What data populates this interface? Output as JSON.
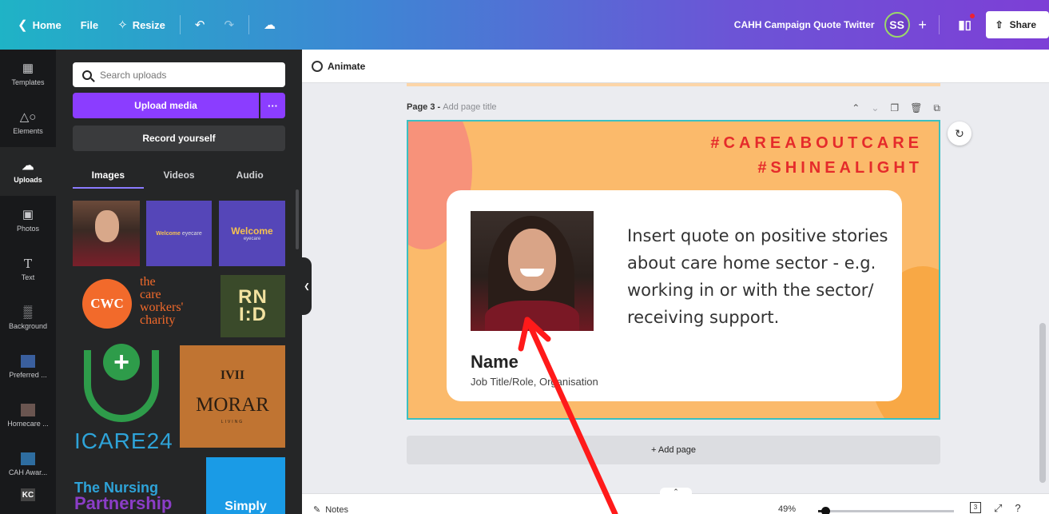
{
  "topbar": {
    "home_label": "Home",
    "file_label": "File",
    "resize_label": "Resize",
    "doc_title": "CAHH Campaign Quote Twitter",
    "avatar_initials": "SS",
    "plus": "+",
    "share_label": "Share"
  },
  "rail": {
    "items": [
      {
        "label": "Templates",
        "icon": "layout-icon"
      },
      {
        "label": "Elements",
        "icon": "shapes-icon"
      },
      {
        "label": "Uploads",
        "icon": "cloud-upload-icon"
      },
      {
        "label": "Photos",
        "icon": "photo-icon"
      },
      {
        "label": "Text",
        "icon": "text-icon"
      },
      {
        "label": "Background",
        "icon": "pattern-icon"
      },
      {
        "label": "Preferred ...",
        "icon": "folder-thumb"
      },
      {
        "label": "Homecare ...",
        "icon": "folder-thumb"
      },
      {
        "label": "CAH Awar...",
        "icon": "folder-thumb"
      },
      {
        "label": "",
        "icon": "folder-thumb",
        "glyph": "KC"
      }
    ],
    "active": "Uploads"
  },
  "panel": {
    "search_placeholder": "Search uploads",
    "upload_label": "Upload media",
    "more_label": "···",
    "record_label": "Record yourself",
    "tabs": [
      "Images",
      "Videos",
      "Audio"
    ],
    "active_tab": "Images",
    "thumbs": {
      "welcome_a": "Welcome",
      "welcome_a_sub": "eyecare",
      "welcome_b": "Welcome",
      "welcome_b_sub": "eyecare",
      "cwc_mark": "CWC",
      "cwc_line1": "the",
      "cwc_line2": "care",
      "cwc_line3": "workers'",
      "cwc_line4": "charity",
      "rnid_line1": "RN",
      "rnid_line2": "I:D",
      "icare": "ICARE24",
      "morar_mark": "IVII",
      "morar_name": "MORAR",
      "morar_sub": "LIVING",
      "nursing_line1": "The Nursing",
      "nursing_line2": "Partnership",
      "simply": "Simply"
    }
  },
  "main": {
    "animate_label": "Animate",
    "page_label": "Page 3 - ",
    "page_title_placeholder": "Add page title",
    "design": {
      "hashtag1": "#CAREABOUTCARE",
      "hashtag2": "#SHINEALIGHT",
      "quote": "Insert quote on positive stories about care home sector - e.g. working in or with the sector/ receiving support.",
      "name": "Name",
      "job_title": "Job Title/Role, Organisation"
    },
    "add_page_label": "+ Add page",
    "notes_label": "Notes",
    "zoom": "49%",
    "zoom_fraction": 0.05,
    "page_count": "3"
  },
  "colors": {
    "accent": "#8b3dff",
    "canvas_bg": "#fbba6b",
    "hashtag": "#e52b2b",
    "selection": "#3bbfc1",
    "arrow": "#ff1a1a"
  }
}
